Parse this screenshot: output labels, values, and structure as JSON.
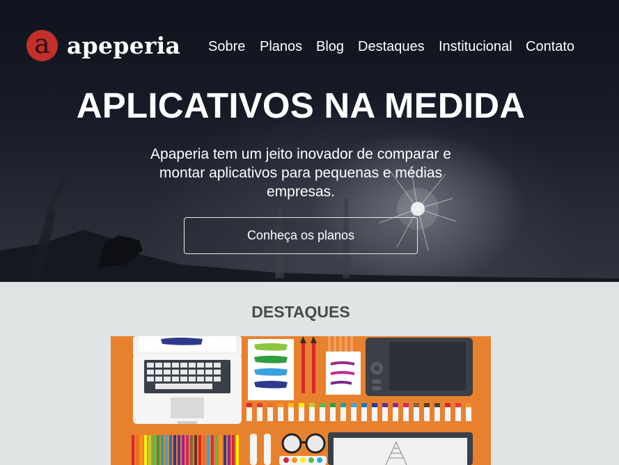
{
  "brand": {
    "mark": "a",
    "name": "apeperia",
    "mark_color": "#c3302b"
  },
  "nav": {
    "items": [
      {
        "label": "Sobre"
      },
      {
        "label": "Planos"
      },
      {
        "label": "Blog"
      },
      {
        "label": "Destaques"
      },
      {
        "label": "Institucional"
      },
      {
        "label": "Contato"
      }
    ]
  },
  "hero": {
    "title": "APLICATIVOS NA MEDIDA",
    "subtitle": "Apaperia tem um jeito inovador de comparar e montar aplicativos para pequenas e médias empresas.",
    "cta_label": "Conheça os planos"
  },
  "highlights": {
    "title": "DESTAQUES",
    "image_icon": "design-workspace-illustration",
    "accent_color": "#e8812e"
  },
  "colors": {
    "section_bg": "#e1e4e5",
    "hero_text": "#ffffff",
    "heading": "#4a4a4a"
  }
}
